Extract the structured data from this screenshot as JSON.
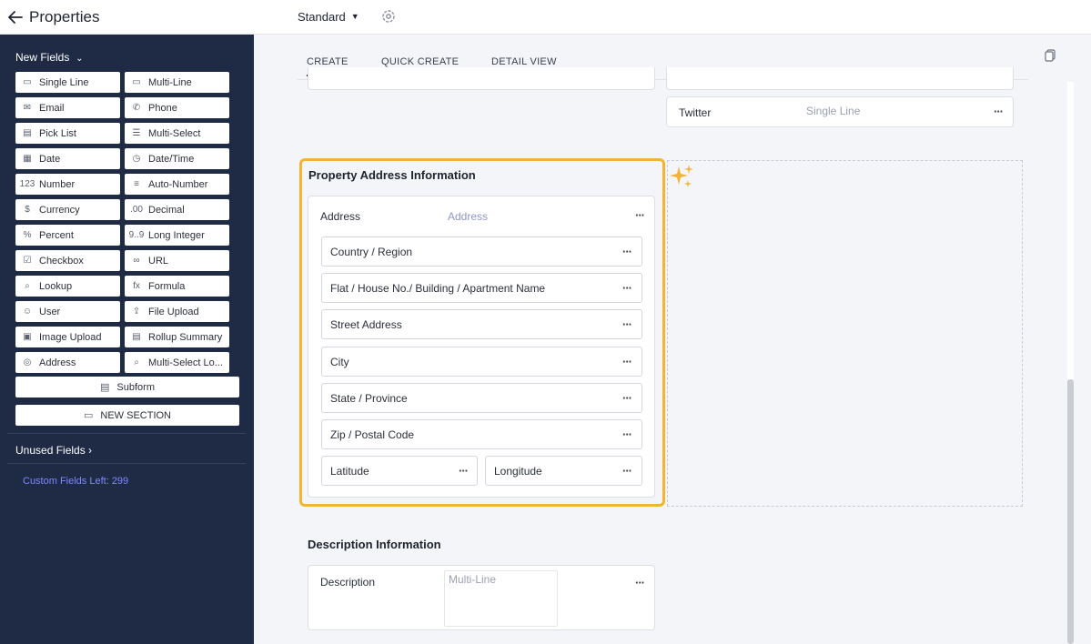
{
  "header": {
    "title": "Properties",
    "layout": "Standard"
  },
  "sidebar": {
    "new_fields_label": "New Fields",
    "fields": [
      {
        "label": "Single Line",
        "icon": "▭"
      },
      {
        "label": "Multi-Line",
        "icon": "▭"
      },
      {
        "label": "Email",
        "icon": "✉"
      },
      {
        "label": "Phone",
        "icon": "✆"
      },
      {
        "label": "Pick List",
        "icon": "▤"
      },
      {
        "label": "Multi-Select",
        "icon": "☰"
      },
      {
        "label": "Date",
        "icon": "▦"
      },
      {
        "label": "Date/Time",
        "icon": "◷"
      },
      {
        "label": "Number",
        "icon": "123"
      },
      {
        "label": "Auto-Number",
        "icon": "≡"
      },
      {
        "label": "Currency",
        "icon": "$"
      },
      {
        "label": "Decimal",
        "icon": ".00"
      },
      {
        "label": "Percent",
        "icon": "%"
      },
      {
        "label": "Long Integer",
        "icon": "9..9"
      },
      {
        "label": "Checkbox",
        "icon": "☑"
      },
      {
        "label": "URL",
        "icon": "∞"
      },
      {
        "label": "Lookup",
        "icon": "⌕"
      },
      {
        "label": "Formula",
        "icon": "fx"
      },
      {
        "label": "User",
        "icon": "☺"
      },
      {
        "label": "File Upload",
        "icon": "⇪"
      },
      {
        "label": "Image Upload",
        "icon": "▣"
      },
      {
        "label": "Rollup Summary",
        "icon": "▤"
      },
      {
        "label": "Address",
        "icon": "◎"
      },
      {
        "label": "Multi-Select Lo...",
        "icon": "⌕"
      }
    ],
    "subform_label": "Subform",
    "new_section_label": "NEW SECTION",
    "unused_fields_label": "Unused Fields",
    "custom_fields_left": "Custom Fields Left: 299"
  },
  "tabs": [
    "CREATE",
    "QUICK CREATE",
    "DETAIL VIEW"
  ],
  "twitter_field": {
    "label": "Twitter",
    "type": "Single Line"
  },
  "address_section": {
    "title": "Property Address Information",
    "field_label": "Address",
    "field_type": "Address",
    "subfields": [
      "Country / Region",
      "Flat / House No./ Building / Apartment Name",
      "Street Address",
      "City",
      "State / Province",
      "Zip / Postal Code"
    ],
    "latitude": "Latitude",
    "longitude": "Longitude"
  },
  "description_section": {
    "title": "Description Information",
    "field_label": "Description",
    "field_type": "Multi-Line"
  },
  "colors": {
    "sidebar_bg": "#1f2a44",
    "highlight": "#f2b533",
    "custom_fields_text": "#7e88ff"
  }
}
